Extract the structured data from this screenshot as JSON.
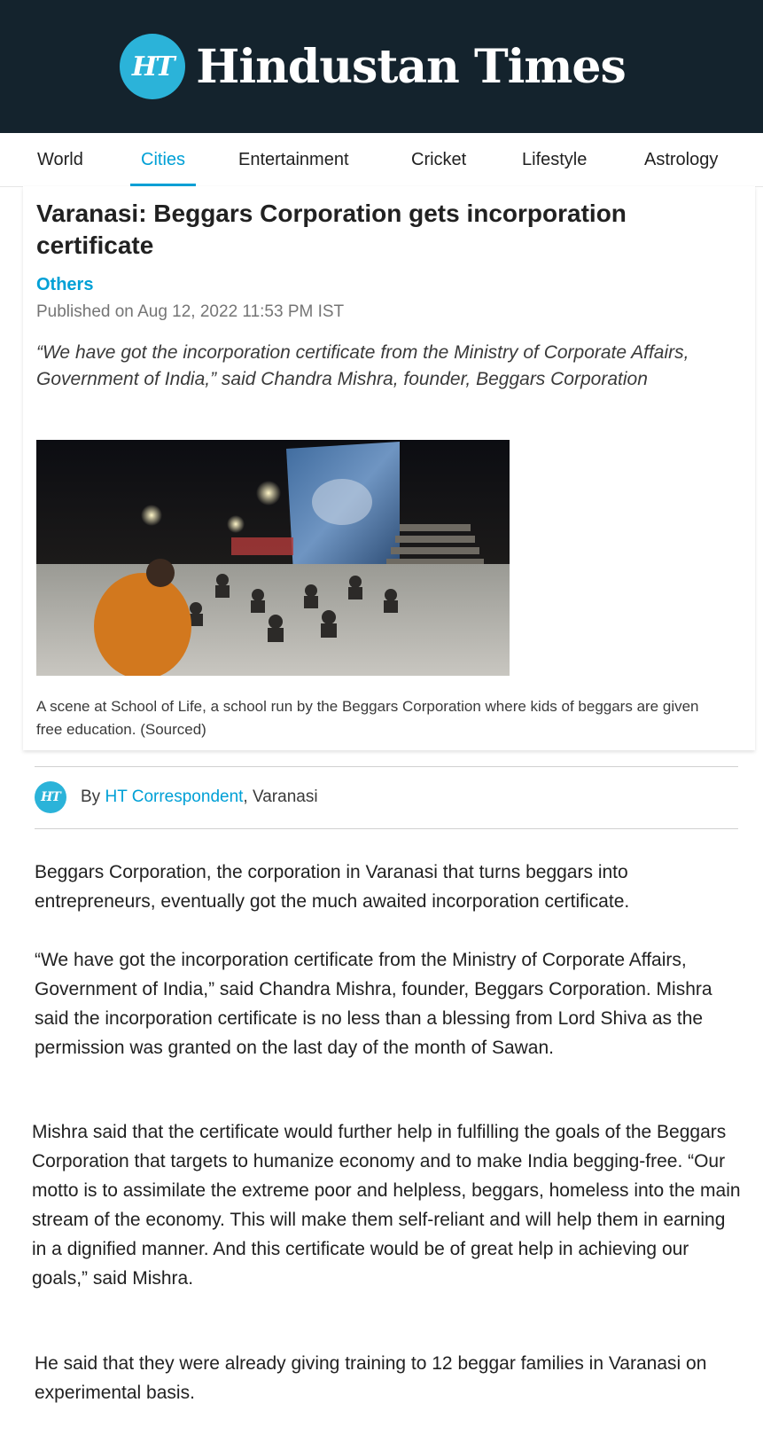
{
  "brand": {
    "logo_mark": "HT",
    "name": "Hindustan Times",
    "accent_color": "#00a0d6",
    "masthead_color": "#14232d"
  },
  "nav": {
    "items": [
      {
        "label": "World"
      },
      {
        "label": "Cities",
        "active": true
      },
      {
        "label": "Entertainment"
      },
      {
        "label": "Cricket"
      },
      {
        "label": "Lifestyle"
      },
      {
        "label": "Astrology"
      }
    ]
  },
  "article": {
    "headline": "Varanasi: Beggars Corporation gets incorporation certificate",
    "section": "Others",
    "published": "Published on Aug 12, 2022 11:53 PM IST",
    "summary": "“We have got the incorporation certificate from the Ministry of Corporate Affairs, Government of India,” said Chandra Mishra, founder, Beggars Corporation",
    "caption": "A scene at School of Life, a school run by the Beggars Corporation where kids of beggars are given free education. (Sourced)",
    "byline": {
      "prefix": "By",
      "author": "HT Correspondent",
      "location": ", Varanasi"
    },
    "paragraphs": [
      "Beggars Corporation, the corporation in Varanasi that turns beggars into entrepreneurs, eventually got the much awaited incorporation certificate.",
      "“We have got the incorporation certificate from the Ministry of Corporate Affairs, Government of India,” said Chandra Mishra, founder, Beggars Corporation. Mishra said the incorporation certificate is no less than a blessing from Lord Shiva as the permission was granted on the last day of the month of Sawan.",
      "Mishra said that the certificate would further help in fulfilling the goals of the Beggars Corporation that targets to humanize economy and to make India begging-free. “Our motto is to assimilate the extreme poor and helpless, beggars, homeless into the main stream of the economy. This will make them self-reliant and will help them in earning in a dignified manner. And this certificate would be of great help in achieving our goals,” said Mishra.",
      "He said that they were already giving training to 12 beggar families in Varanasi on experimental basis."
    ]
  }
}
